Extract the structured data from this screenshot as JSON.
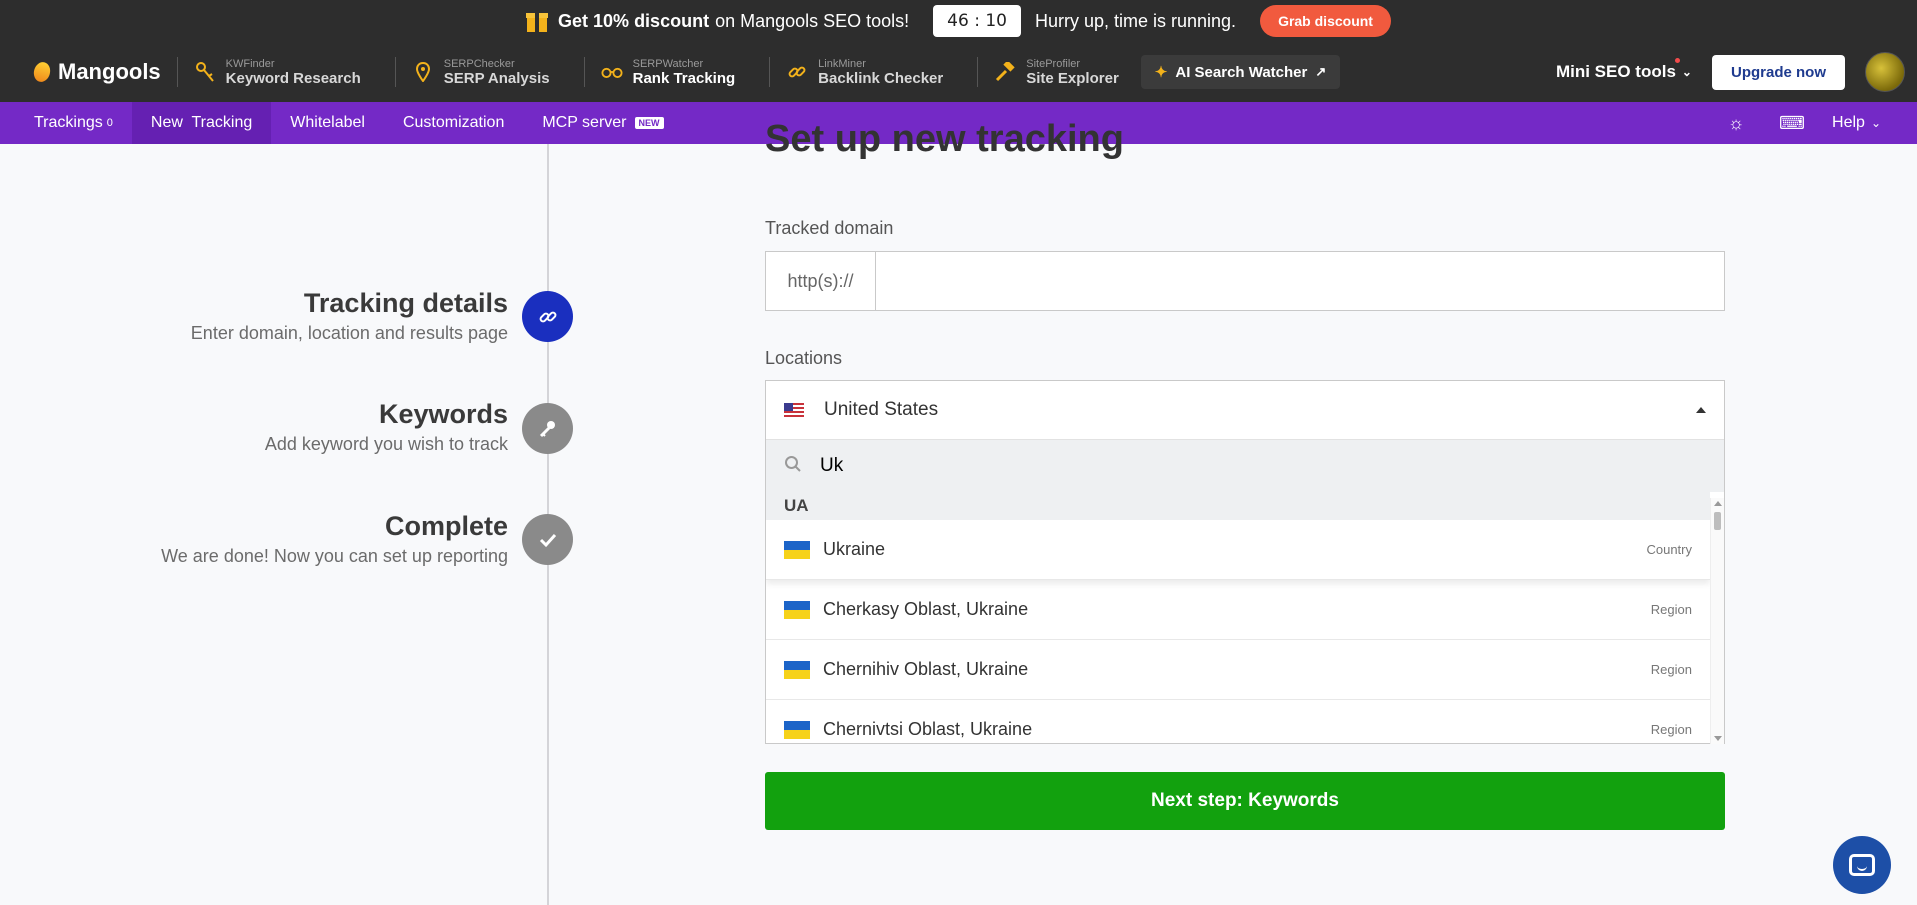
{
  "promo": {
    "strong_text": "Get 10% discount",
    "text": "on Mangools SEO tools!",
    "timer": "46 : 10",
    "hurry_text": "Hurry up, time is running.",
    "grab_label": "Grab discount"
  },
  "header": {
    "logo": "Mangools",
    "tools": [
      {
        "small": "KWFinder",
        "big": "Keyword Research",
        "icon": "key-icon"
      },
      {
        "small": "SERPChecker",
        "big": "SERP Analysis",
        "icon": "pin-icon"
      },
      {
        "small": "SERPWatcher",
        "big": "Rank Tracking",
        "icon": "binoculars-icon"
      },
      {
        "small": "LinkMiner",
        "big": "Backlink Checker",
        "icon": "link-icon"
      },
      {
        "small": "SiteProfiler",
        "big": "Site Explorer",
        "icon": "hammer-icon"
      }
    ],
    "ai_watcher": "AI Search Watcher",
    "mini_tools": "Mini SEO tools",
    "upgrade": "Upgrade now"
  },
  "subnav": {
    "items": [
      {
        "label": "Trackings",
        "count": "0"
      },
      {
        "label": "New  Tracking"
      },
      {
        "label": "Whitelabel"
      },
      {
        "label": "Customization"
      },
      {
        "label": "MCP server",
        "badge": "NEW"
      }
    ],
    "help": "Help"
  },
  "steps": [
    {
      "title": "Tracking details",
      "desc": "Enter domain, location and results page",
      "icon": "link-icon",
      "state": "active"
    },
    {
      "title": "Keywords",
      "desc": "Add keyword you wish to track",
      "icon": "key-icon",
      "state": "idle"
    },
    {
      "title": "Complete",
      "desc": "We are done! Now you can set up reporting",
      "icon": "check-icon",
      "state": "idle"
    }
  ],
  "form": {
    "heading": "Set up new tracking",
    "domain_label": "Tracked domain",
    "domain_prefix": "http(s)://",
    "domain_value": "",
    "locations_label": "Locations",
    "selected_location": "United States",
    "search_value": "Uk",
    "group_label": "UA",
    "results": [
      {
        "name": "Ukraine",
        "kind": "Country"
      },
      {
        "name": "Cherkasy Oblast, Ukraine",
        "kind": "Region"
      },
      {
        "name": "Chernihiv Oblast, Ukraine",
        "kind": "Region"
      },
      {
        "name": "Chernivtsi Oblast, Ukraine",
        "kind": "Region"
      }
    ],
    "next_label": "Next step: Keywords"
  },
  "colors": {
    "purple_nav": "#7429c6",
    "next_green": "#12a10e",
    "active_step": "#1a2fbf"
  }
}
